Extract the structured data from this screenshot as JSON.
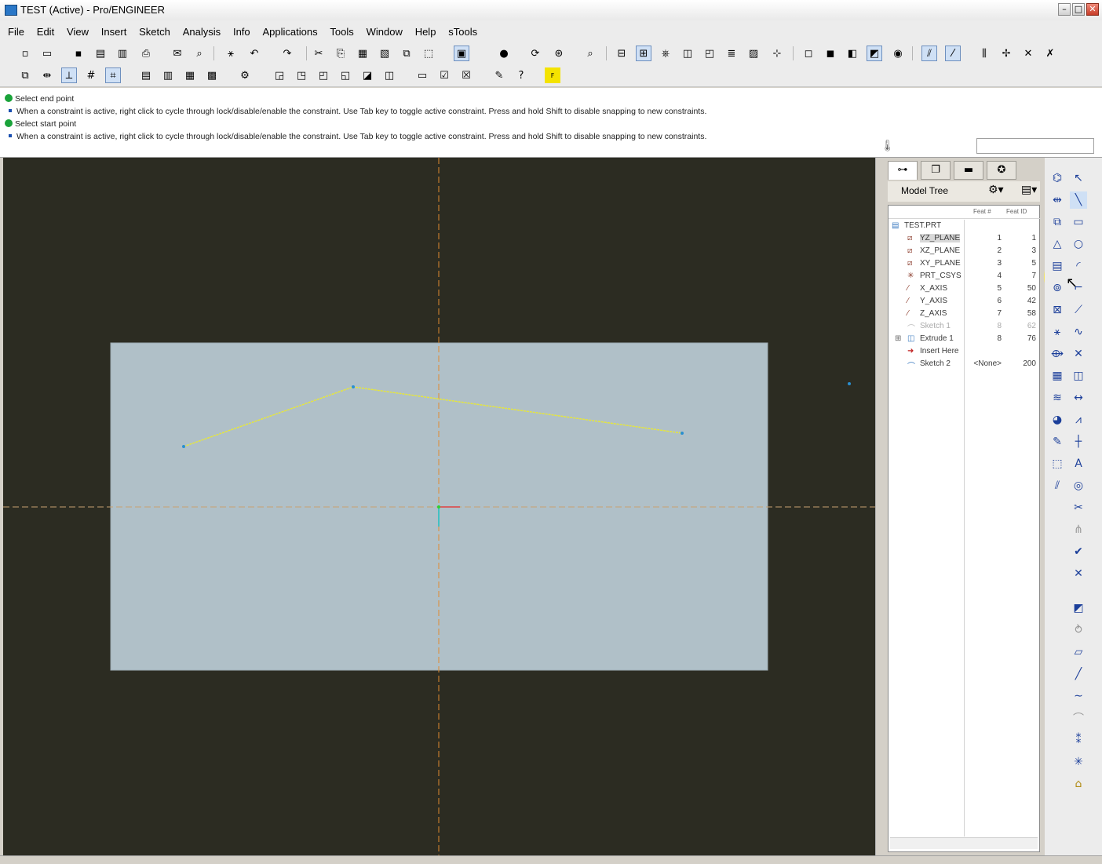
{
  "window": {
    "title": "TEST (Active) - Pro/ENGINEER",
    "controls": [
      "minimize",
      "maximize",
      "close"
    ]
  },
  "menu": [
    "File",
    "Edit",
    "View",
    "Insert",
    "Sketch",
    "Analysis",
    "Info",
    "Applications",
    "Tools",
    "Window",
    "Help",
    "sTools"
  ],
  "messages": [
    {
      "type": "prompt",
      "text": "Select end point"
    },
    {
      "type": "info",
      "text": "When a constraint is active, right click to cycle through lock/disable/enable the constraint. Use Tab key to toggle active constraint. Press and hold Shift to disable snapping to new constraints."
    },
    {
      "type": "prompt",
      "text": "Select start point"
    },
    {
      "type": "info",
      "text": "When a constraint is active, right click to cycle through lock/disable/enable the constraint. Use Tab key to toggle active constraint. Press and hold Shift to disable snapping to new constraints."
    }
  ],
  "toolbar_icons": {
    "new": "◻",
    "open": "📂",
    "save": "💾",
    "print": "🖶",
    "undo": "↶",
    "redo": "↷",
    "cut": "✂",
    "copy": "⎘",
    "paste": "📋",
    "regenerate": "⟳",
    "repaint": "▣",
    "sketch_display": "⬚",
    "zoom": "🔍",
    "orient": "◈",
    "spin": "⊕"
  },
  "nav": {
    "title": "Model Tree",
    "columns": {
      "feat_no": "Feat #",
      "feat_id": "Feat ID"
    },
    "root": "TEST.PRT",
    "items": [
      {
        "name": "YZ_PLANE",
        "no": "1",
        "id": "1",
        "icon": "plane"
      },
      {
        "name": "XZ_PLANE",
        "no": "2",
        "id": "3",
        "icon": "plane"
      },
      {
        "name": "XY_PLANE",
        "no": "3",
        "id": "5",
        "icon": "plane"
      },
      {
        "name": "PRT_CSYS",
        "no": "4",
        "id": "7",
        "icon": "csys"
      },
      {
        "name": "X_AXIS",
        "no": "5",
        "id": "50",
        "icon": "axis"
      },
      {
        "name": "Y_AXIS",
        "no": "6",
        "id": "42",
        "icon": "axis"
      },
      {
        "name": "Z_AXIS",
        "no": "7",
        "id": "58",
        "icon": "axis"
      },
      {
        "name": "Sketch 1",
        "no": "8",
        "id": "62",
        "icon": "sketch"
      },
      {
        "name": "Extrude 1",
        "no": "8",
        "id": "76",
        "icon": "extrude"
      },
      {
        "name": "Insert Here",
        "no": "",
        "id": "",
        "icon": "insert"
      },
      {
        "name": "Sketch 2",
        "no": "<None>",
        "id": "200",
        "icon": "sketch"
      }
    ]
  },
  "colors": {
    "viewport_bg": "#2c2c22",
    "plane_face": "#b0c0c8",
    "sketch_line": "#e6e63c",
    "datum_line": "#e08a30",
    "highlight": "#ffeb3c"
  }
}
